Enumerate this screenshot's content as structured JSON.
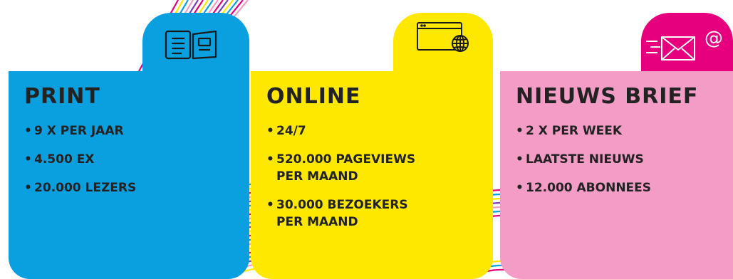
{
  "colors": {
    "print": "#0aa0df",
    "online": "#ffe800",
    "newsletter": "#f29cc6",
    "newsletter_tab": "#e6007e"
  },
  "cards": [
    {
      "title": "PRINT",
      "icon": "open-book-icon",
      "items": [
        "9 X PER JAAR",
        "4.500 EX",
        "20.000 LEZERS"
      ]
    },
    {
      "title": "ONLINE",
      "icon": "browser-globe-icon",
      "items": [
        "24/7",
        "520.000 PAGEVIEWS",
        "PER MAAND",
        "30.000 BEZOEKERS",
        "PER MAAND"
      ]
    },
    {
      "title": "NIEUWS BRIEF",
      "icon": "email-at-icon",
      "items": [
        "2 X PER WEEK",
        "LAATSTE NIEUWS",
        "12.000 ABONNEES"
      ]
    }
  ],
  "bullet": "•"
}
